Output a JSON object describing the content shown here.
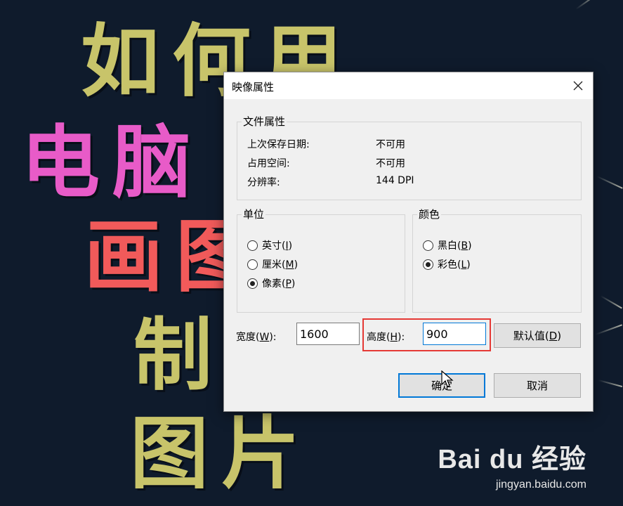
{
  "background": {
    "lines": [
      {
        "text": "如何用",
        "color": "#c8c46a"
      },
      {
        "text": "电脑",
        "color": "#e85bc8"
      },
      {
        "text": "画图",
        "color": "#f15a5a"
      },
      {
        "text": "制",
        "color": "#c8c46a"
      },
      {
        "text": "图片",
        "color": "#c8c46a"
      }
    ]
  },
  "watermark": {
    "logo": "Bai du 经验",
    "site": "jingyan.baidu.com"
  },
  "dialog": {
    "title": "映像属性",
    "file_properties": {
      "label": "文件属性",
      "rows": [
        {
          "name": "上次保存日期:",
          "value": "不可用"
        },
        {
          "name": "占用空间:",
          "value": "不可用"
        },
        {
          "name": "分辨率:",
          "value": "144 DPI"
        }
      ]
    },
    "units": {
      "label": "单位",
      "options": [
        {
          "text": "英寸",
          "key": "I",
          "checked": false
        },
        {
          "text": "厘米",
          "key": "M",
          "checked": false
        },
        {
          "text": "像素",
          "key": "P",
          "checked": true
        }
      ]
    },
    "colors": {
      "label": "颜色",
      "options": [
        {
          "text": "黑白",
          "key": "B",
          "checked": false
        },
        {
          "text": "彩色",
          "key": "L",
          "checked": true
        }
      ]
    },
    "width": {
      "label_pre": "宽度(",
      "key": "W",
      "label_post": "):",
      "value": "1600"
    },
    "height": {
      "label_pre": "高度(",
      "key": "H",
      "label_post": "):",
      "value": "900"
    },
    "default_button": {
      "pre": "默认值(",
      "key": "D",
      "post": ")"
    },
    "ok_button": "确定",
    "cancel_button": "取消",
    "highlight_color": "#e53935",
    "accent_color": "#0078d7"
  }
}
